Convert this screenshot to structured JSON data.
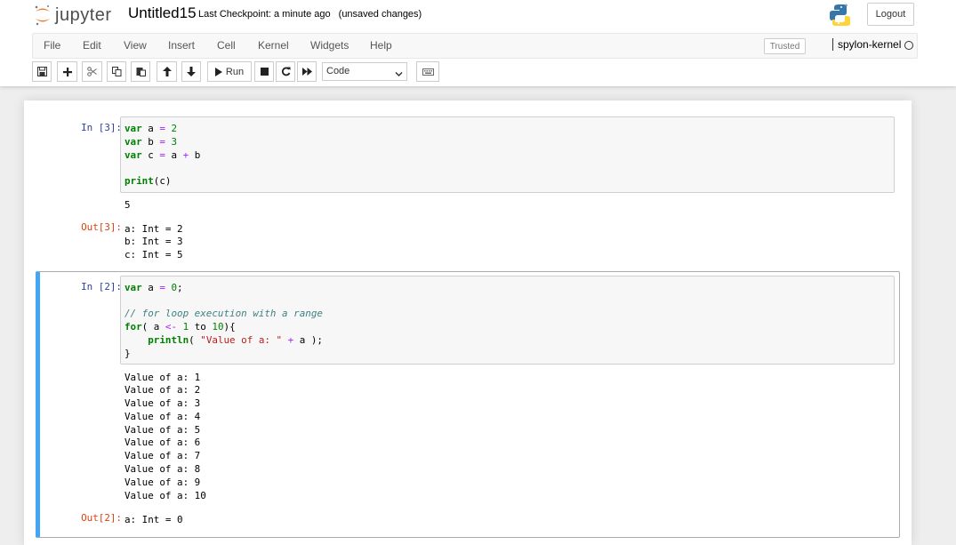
{
  "header": {
    "logo_text": "jupyter",
    "notebook_name": "Untitled15",
    "checkpoint": "Last Checkpoint: a minute ago",
    "autosave_status": "(unsaved changes)",
    "logout_label": "Logout"
  },
  "menubar": {
    "items": [
      "File",
      "Edit",
      "View",
      "Insert",
      "Cell",
      "Kernel",
      "Widgets",
      "Help"
    ],
    "trusted_label": "Trusted",
    "kernel_name": "spylon-kernel"
  },
  "toolbar": {
    "run_label": "Run",
    "cell_type": "Code"
  },
  "cells": [
    {
      "in_prompt": "In [3]:",
      "code": [
        "var a = 2",
        "var b = 3",
        "var c = a + b",
        "",
        "print(c)"
      ],
      "stdout": [
        "5"
      ],
      "out_prompt": "Out[3]:",
      "result": [
        "a: Int = 2",
        "b: Int = 3",
        "c: Int = 5"
      ]
    },
    {
      "in_prompt": "In [2]:",
      "code": [
        "var a = 0;",
        "",
        "// for loop execution with a range",
        "for( a <- 1 to 10){",
        "    println( \"Value of a: \" + a );",
        "}"
      ],
      "stdout": [
        "Value of a: 1",
        "Value of a: 2",
        "Value of a: 3",
        "Value of a: 4",
        "Value of a: 5",
        "Value of a: 6",
        "Value of a: 7",
        "Value of a: 8",
        "Value of a: 9",
        "Value of a: 10"
      ],
      "out_prompt": "Out[2]:",
      "result": [
        "a: Int = 0"
      ]
    }
  ],
  "colors": {
    "selected_cell_accent": "#42a5f5",
    "in_prompt": "#303f9f",
    "out_prompt": "#d84315",
    "keyword": "#008000",
    "comment": "#408080",
    "string": "#ba2121",
    "operator": "#aa22ff"
  }
}
